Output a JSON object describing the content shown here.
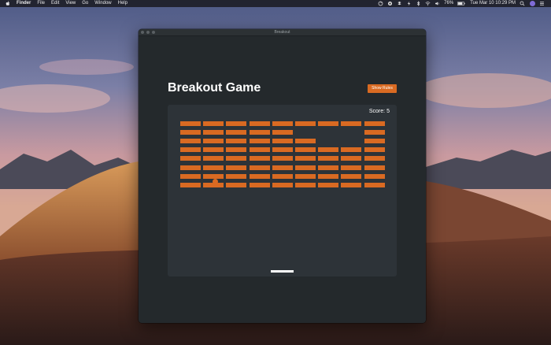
{
  "menubar": {
    "app_name": "Finder",
    "menus": [
      "File",
      "Edit",
      "View",
      "Go",
      "Window",
      "Help"
    ],
    "battery_percent": "76%",
    "clock": "Tue Mar 10  10:29 PM"
  },
  "window": {
    "title": "Breakout"
  },
  "game": {
    "title": "Breakout Game",
    "rules_button_label": "Show Rules",
    "score_label": "Score:",
    "score_value": "5",
    "brick_columns": 9,
    "brick_rows": 8,
    "broken_bricks": [
      [
        5,
        1
      ],
      [
        6,
        1
      ],
      [
        7,
        1
      ],
      [
        6,
        2
      ],
      [
        7,
        2
      ]
    ],
    "ball_color": "#d96a22",
    "brick_color": "#d96a22",
    "paddle_color": "#ffffff"
  },
  "colors": {
    "accent": "#d96a22",
    "window_bg": "#24292c",
    "canvas_bg": "#2d3338"
  }
}
